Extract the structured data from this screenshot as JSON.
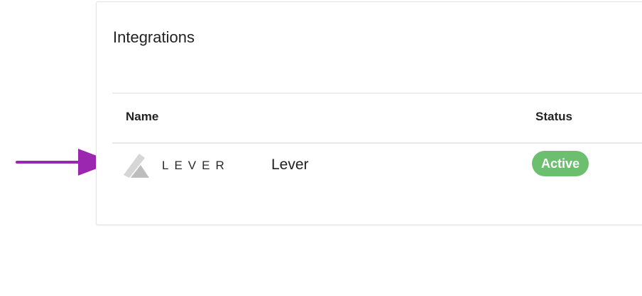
{
  "card": {
    "title": "Integrations"
  },
  "table": {
    "columns": [
      "Name",
      "Status"
    ],
    "rows": [
      {
        "logo_text": "LEVER",
        "logo_icon": "lever-logo-icon",
        "name": "Lever",
        "status": "Active"
      }
    ]
  },
  "colors": {
    "status_active": "#6cbf6f",
    "annotation_arrow": "#9b27b0"
  }
}
